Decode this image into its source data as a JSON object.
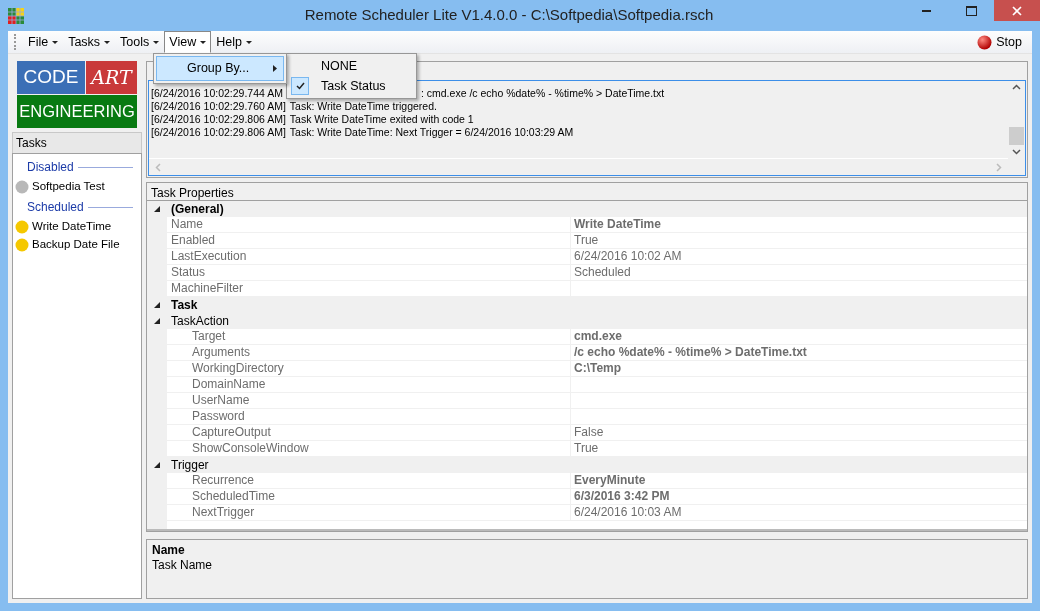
{
  "window": {
    "title": "Remote Scheduler Lite V1.4.0.0 - C:\\Softpedia\\Softpedia.rsch"
  },
  "menu": [
    {
      "label": "File",
      "selected": false
    },
    {
      "label": "Tasks",
      "selected": false
    },
    {
      "label": "Tools",
      "selected": false
    },
    {
      "label": "View",
      "selected": true
    },
    {
      "label": "Help",
      "selected": false
    }
  ],
  "dropdown": {
    "items": [
      {
        "label": "Group By...",
        "selected": true,
        "submenu": [
          {
            "label": "NONE",
            "checked": false
          },
          {
            "label": "Task Status",
            "checked": true
          }
        ]
      }
    ]
  },
  "stop_button": "Stop",
  "logo": {
    "word_1": "CODE",
    "word_2": "ART",
    "word_3": "ENGINEERING"
  },
  "tasks_panel": {
    "title": "Tasks",
    "groups": [
      {
        "label": "Disabled",
        "items": [
          {
            "label": "Softpedia Test",
            "color": "#b8b8b8",
            "selected": false
          }
        ]
      },
      {
        "label": "Scheduled",
        "items": [
          {
            "label": "Write DateTime",
            "color": "#f5c800",
            "selected": false
          },
          {
            "label": "Backup Date File",
            "color": "#f5c800",
            "selected": false
          }
        ]
      }
    ]
  },
  "log": {
    "lines": [
      {
        "time": "[6/24/2016 10:02:29.744 AM",
        "text": ": cmd.exe /c echo %date% - %time% > DateTime.txt"
      },
      {
        "time": "[6/24/2016 10:02:29.760 AM]",
        "text": "Task: Write DateTime triggered."
      },
      {
        "time": "[6/24/2016 10:02:29.806 AM]",
        "text": "Task Write DateTime exited with code 1"
      },
      {
        "time": "[6/24/2016 10:02:29.806 AM]",
        "text": "Task: Write DateTime: Next Trigger = 6/24/2016 10:03:29 AM"
      }
    ]
  },
  "properties": {
    "title": "Task Properties",
    "categories": [
      {
        "label": "(General)",
        "expanded": true,
        "children": [
          {
            "name": "Name",
            "value": "Write DateTime",
            "modified": true
          },
          {
            "name": "Enabled",
            "value": "True",
            "modified": false
          },
          {
            "name": "LastExecution",
            "value": "6/24/2016 10:02 AM",
            "modified": false
          },
          {
            "name": "Status",
            "value": "Scheduled",
            "modified": false
          },
          {
            "name": "MachineFilter",
            "modified": false
          }
        ]
      },
      {
        "label": "Task",
        "expanded": true,
        "children": [
          {
            "label": "TaskAction",
            "expanded": true,
            "children": [
              {
                "name": "Target",
                "value": "cmd.exe",
                "modified": true
              },
              {
                "name": "Arguments",
                "value": "/c echo %date% - %time% > DateTime.txt",
                "modified": true
              },
              {
                "name": "WorkingDirectory",
                "value": "C:\\Temp",
                "modified": true
              },
              {
                "name": "DomainName",
                "modified": false
              },
              {
                "name": "UserName",
                "modified": false
              },
              {
                "name": "Password",
                "modified": false
              },
              {
                "name": "CaptureOutput",
                "value": "False",
                "modified": false
              },
              {
                "name": "ShowConsoleWindow",
                "value": "True",
                "modified": false
              }
            ]
          },
          {
            "label": "Trigger",
            "expanded": true,
            "children": [
              {
                "name": "Recurrence",
                "value": "EveryMinute",
                "modified": true
              },
              {
                "name": "ScheduledTime",
                "value": "6/3/2016 3:42 PM",
                "modified": true
              },
              {
                "name": "NextTrigger",
                "value": "6/24/2016 10:03 AM",
                "modified": false
              }
            ]
          }
        ]
      }
    ]
  },
  "description": {
    "title": "Name",
    "text": "Task Name"
  }
}
